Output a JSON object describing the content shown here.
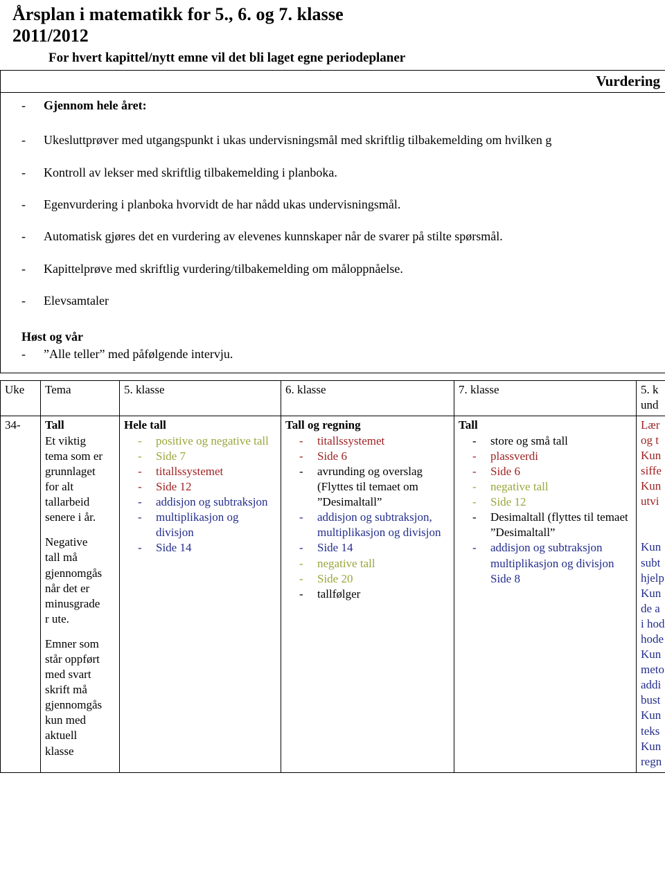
{
  "document": {
    "title": "Årsplan i matematikk for 5., 6. og 7. klasse",
    "subtitle": "2011/2012",
    "periodplan_note": "For hvert kapittel/nytt emne vil det bli laget egne periodeplaner"
  },
  "vurdering": {
    "header_label": "Vurdering",
    "intro_bullet": "Gjennom hele året:",
    "bullets": [
      "Ukesluttprøver med utgangspunkt i ukas undervisningsmål med skriftlig tilbakemelding om hvilken g",
      "Kontroll av lekser med skriftlig tilbakemelding i planboka.",
      "Egenvurdering i planboka hvorvidt de har nådd ukas undervisningsmål.",
      "Automatisk gjøres det en vurdering av elevenes kunnskaper når de svarer på stilte spørsmål.",
      "Kapittelprøve med skriftlig vurdering/tilbakemelding om måloppnåelse.",
      "Elevsamtaler"
    ],
    "season_heading": "Høst og vår",
    "season_bullet": "”Alle teller” med påfølgende intervju."
  },
  "schedule": {
    "headers": [
      "Uke",
      "Tema",
      "5. klasse",
      "6. klasse",
      "7. klasse",
      "5. k\nund"
    ],
    "header_last_line1": "5. k",
    "header_last_line2": "und",
    "rows": [
      {
        "uke": "34-",
        "tema": {
          "title": "Tall",
          "paragraph1": [
            "Et viktig",
            "tema som er",
            "grunnlaget",
            "for alt",
            "tallarbeid",
            "senere i år."
          ],
          "paragraph2": [
            "Negative",
            "tall må",
            "gjennomgås",
            "når det er",
            "minusgrade",
            "r ute."
          ],
          "paragraph3": [
            "Emner som",
            "står oppført",
            "med svart",
            "skrift må",
            "gjennomgås",
            "kun med",
            "aktuell",
            "klasse"
          ]
        },
        "klasse5": {
          "title": "Hele tall",
          "items": [
            {
              "text": "positive og negative tall",
              "color": "olive"
            },
            {
              "text": "Side 7",
              "color": "olive"
            },
            {
              "text": "titallssystemet",
              "color": "red"
            },
            {
              "text": "Side 12",
              "color": "red"
            },
            {
              "text": "addisjon og subtraksjon",
              "color": "blue"
            },
            {
              "text": "multiplikasjon og divisjon",
              "color": "blue"
            },
            {
              "text": "Side 14",
              "color": "blue"
            }
          ]
        },
        "klasse6": {
          "title": "Tall og regning",
          "items": [
            {
              "text": "titallssystemet",
              "color": "red"
            },
            {
              "text": "Side 6",
              "color": "red"
            },
            {
              "text": "avrunding og overslag (Flyttes til temaet om ”Desimaltall”",
              "color": "black"
            },
            {
              "text": "addisjon og subtraksjon, multiplikasjon og divisjon",
              "color": "blue"
            },
            {
              "text": "Side 14",
              "color": "blue"
            },
            {
              "text": "negative tall",
              "color": "olive"
            },
            {
              "text": "Side 20",
              "color": "olive"
            },
            {
              "text": "tallfølger",
              "color": "black"
            }
          ]
        },
        "klasse7": {
          "title": "Tall",
          "items": [
            {
              "text": "store og små tall",
              "color": "black"
            },
            {
              "text": "plassverdi",
              "color": "red"
            },
            {
              "text": "Side 6",
              "color": "red"
            },
            {
              "text": "negative tall",
              "color": "olive"
            },
            {
              "text": "Side 12",
              "color": "olive"
            },
            {
              "text": "Desimaltall (flyttes til temaet ”Desimaltall”",
              "color": "black"
            },
            {
              "text": "addisjon og subtraksjon multiplikasjon og divisjon Side 8",
              "color": "blue"
            }
          ]
        },
        "mal_lines": [
          {
            "text": "Lær",
            "color": "red"
          },
          {
            "text": "og t",
            "color": "red"
          },
          {
            "text": "Kun",
            "color": "red"
          },
          {
            "text": "siffe",
            "color": "red"
          },
          {
            "text": "Kun",
            "color": "red"
          },
          {
            "text": "utvi",
            "color": "red"
          },
          {
            "text": "",
            "color": "red"
          },
          {
            "text": "",
            "color": "red"
          },
          {
            "text": "Kun",
            "color": "blue"
          },
          {
            "text": "subt",
            "color": "blue"
          },
          {
            "text": "hjelp",
            "color": "blue"
          },
          {
            "text": "Kun",
            "color": "blue"
          },
          {
            "text": "de a",
            "color": "blue"
          },
          {
            "text": "i hod",
            "color": "blue"
          },
          {
            "text": "hode",
            "color": "blue"
          },
          {
            "text": "Kun",
            "color": "blue"
          },
          {
            "text": "meto",
            "color": "blue"
          },
          {
            "text": "addi",
            "color": "blue"
          },
          {
            "text": "bust",
            "color": "blue"
          },
          {
            "text": "Kun",
            "color": "blue"
          },
          {
            "text": "teks",
            "color": "blue"
          },
          {
            "text": "Kun",
            "color": "blue"
          },
          {
            "text": "regn",
            "color": "blue"
          }
        ]
      }
    ]
  }
}
